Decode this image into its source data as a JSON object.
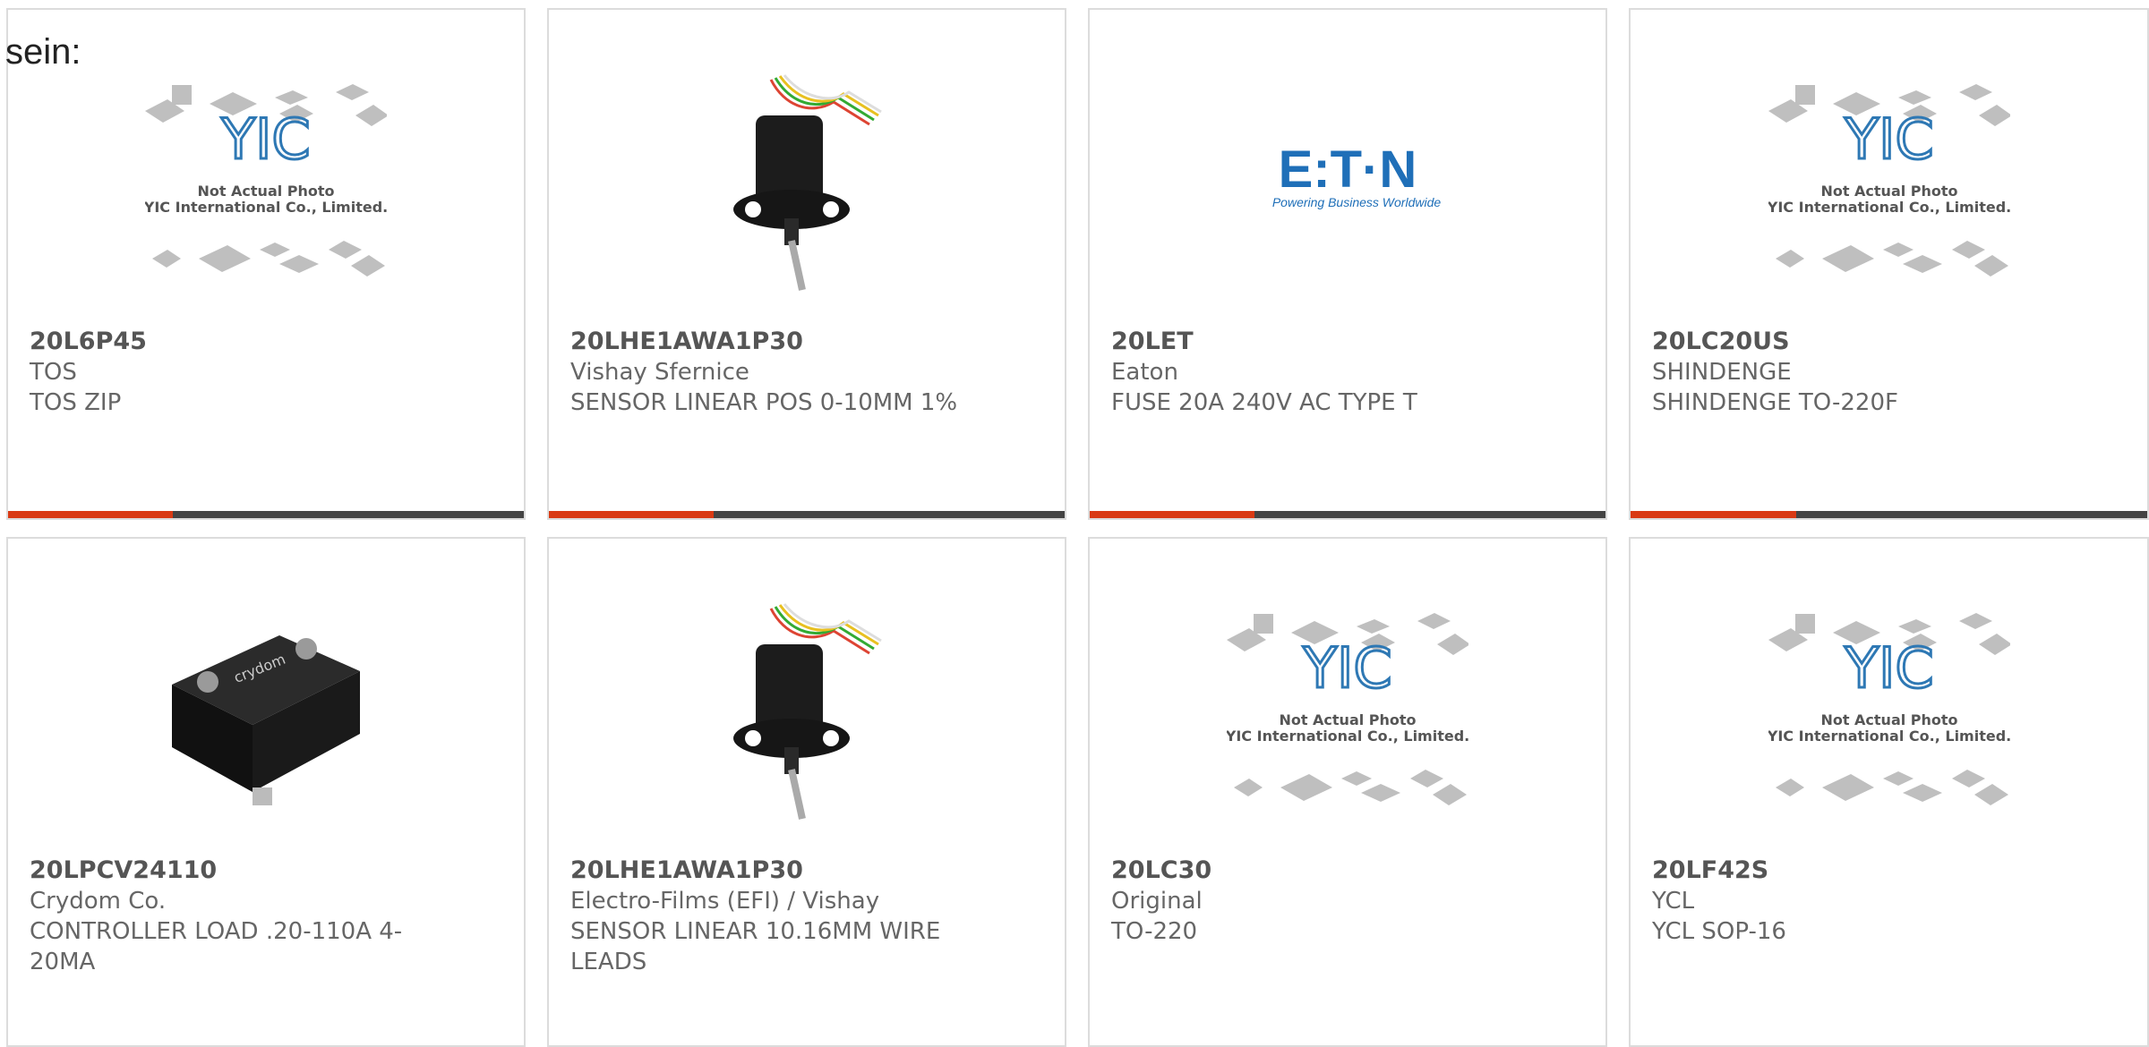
{
  "lead_text": "sein:",
  "colors": {
    "accent": "#d93a14",
    "bar": "#444444",
    "border": "#dcdcdc",
    "text": "#666666",
    "part_number": "#555555"
  },
  "placeholder_image": {
    "line1": "Not Actual Photo",
    "line2": "YIC International Co., Limited.",
    "logo": "YIC"
  },
  "eaton_logo": {
    "wordmark": "E:T·N",
    "tagline": "Powering Business Worldwide"
  },
  "crydom_brand": "crydom",
  "products": [
    {
      "part_number": "20L6P45",
      "manufacturer": "TOS",
      "description": "TOS ZIP",
      "image": "placeholder-icon"
    },
    {
      "part_number": "20LHE1AWA1P30",
      "manufacturer": "Vishay Sfernice",
      "description": "SENSOR LINEAR POS 0-10MM 1%",
      "image": "linear-sensor-photo"
    },
    {
      "part_number": "20LET",
      "manufacturer": "Eaton",
      "description": "FUSE 20A 240V AC TYPE T",
      "image": "eaton-logo"
    },
    {
      "part_number": "20LC20US",
      "manufacturer": "SHINDENGE",
      "description": "SHINDENGE TO-220F",
      "image": "placeholder-icon"
    },
    {
      "part_number": "20LPCV24110",
      "manufacturer": "Crydom Co.",
      "description": "CONTROLLER LOAD .20-110A 4-20MA",
      "image": "crydom-controller-photo"
    },
    {
      "part_number": "20LHE1AWA1P30",
      "manufacturer": "Electro-Films (EFI) / Vishay",
      "description": "SENSOR LINEAR 10.16MM WIRE LEADS",
      "image": "linear-sensor-photo"
    },
    {
      "part_number": "20LC30",
      "manufacturer": "Original",
      "description": "TO-220",
      "image": "placeholder-icon"
    },
    {
      "part_number": "20LF42S",
      "manufacturer": "YCL",
      "description": "YCL SOP-16",
      "image": "placeholder-icon"
    }
  ]
}
